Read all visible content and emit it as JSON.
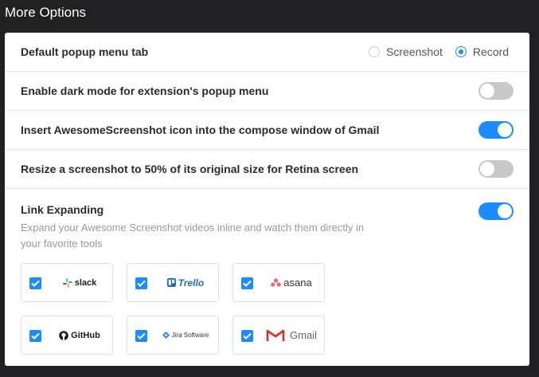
{
  "page": {
    "title": "More Options"
  },
  "options": {
    "popup_tab": {
      "label": "Default popup menu tab",
      "choices": [
        "Screenshot",
        "Record"
      ],
      "selected": "Record"
    },
    "dark_mode": {
      "label": "Enable dark mode for extension's popup menu",
      "enabled": false
    },
    "gmail_icon": {
      "label": "Insert AwesomeScreenshot icon into the compose window of Gmail",
      "enabled": true
    },
    "retina": {
      "label": "Resize a screenshot to 50% of its original size for Retina screen",
      "enabled": false
    },
    "link_expanding": {
      "label": "Link Expanding",
      "description": "Expand your Awesome Screenshot videos inline and watch them directly in your favorite tools",
      "enabled": true,
      "integrations": [
        {
          "name": "slack",
          "checked": true
        },
        {
          "name": "Trello",
          "checked": true
        },
        {
          "name": "asana",
          "checked": true
        },
        {
          "name": "GitHub",
          "checked": true
        },
        {
          "name": "Jira Software",
          "checked": true
        },
        {
          "name": "Gmail",
          "checked": true
        }
      ]
    }
  },
  "colors": {
    "accent": "#1a8cff",
    "toggle_off": "#c8c8c8",
    "background": "#212123"
  }
}
